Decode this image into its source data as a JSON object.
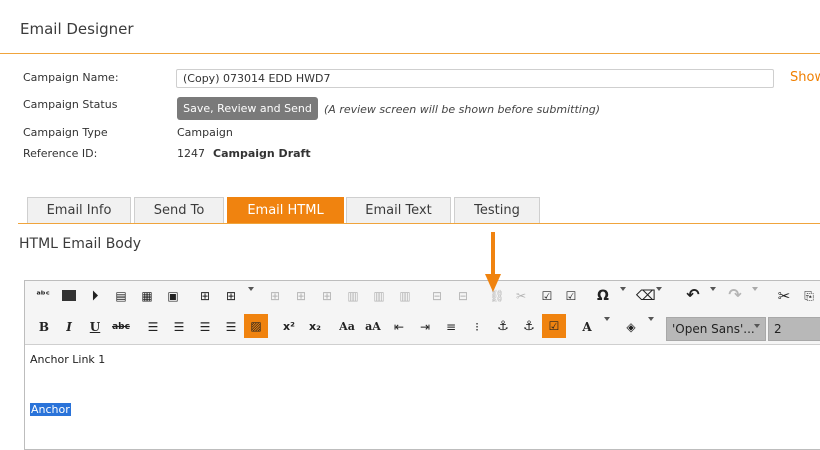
{
  "header": {
    "title": "Email Designer"
  },
  "campaign": {
    "name_label": "Campaign Name:",
    "name_value": "(Copy) 073014 EDD HWD7",
    "show_link": "Show",
    "status_label": "Campaign Status",
    "status_button": "Save, Review and Send",
    "status_note": "(A review screen will be shown before submitting)",
    "type_label": "Campaign Type",
    "type_value": "Campaign",
    "ref_label": "Reference ID:",
    "ref_value": "1247",
    "ref_status": "Campaign Draft"
  },
  "tabs": [
    {
      "label": "Email Info",
      "active": false
    },
    {
      "label": "Send To",
      "active": false
    },
    {
      "label": "Email HTML",
      "active": true
    },
    {
      "label": "Email Text",
      "active": false
    },
    {
      "label": "Testing",
      "active": false
    }
  ],
  "section_title": "HTML Email Body",
  "toolbar": {
    "row1_icons": [
      "spellcheck-icon",
      "image-icon",
      "media-icon",
      "template-icon",
      "page-icon",
      "picture-icon",
      "table-icon",
      "table-grid-icon",
      "table-row-before-icon",
      "table-row-after-icon",
      "table-col-icon",
      "table-cell-icon",
      "table-merge-icon",
      "table-split-icon",
      "table-props-icon",
      "link-icon",
      "unlink-icon",
      "edit-icon",
      "edit-source-icon",
      "special-char-icon",
      "clean-icon",
      "undo-icon",
      "redo-icon",
      "cut-icon",
      "copy-icon"
    ],
    "row2_icons": [
      "bold-icon",
      "italic-icon",
      "underline-icon",
      "strikethrough-icon",
      "align-left-icon",
      "align-center-icon",
      "align-right-icon",
      "justify-icon",
      "hr-icon",
      "superscript-icon",
      "subscript-icon",
      "font-size-up-icon",
      "font-size-down-icon",
      "outdent-icon",
      "indent-icon",
      "ordered-list-icon",
      "unordered-list-icon",
      "anchor-icon",
      "anchor-link-icon",
      "insert-field-icon",
      "font-color-icon",
      "highlight-icon"
    ],
    "bold": "B",
    "italic": "I",
    "underline": "U",
    "strike": "abc",
    "superscript": "x²",
    "subscript": "x₂",
    "font_up": "Aa",
    "font_down": "aA",
    "font_color": "A",
    "omega": "Ω",
    "font_family": "'Open Sans'...",
    "font_size": "2"
  },
  "content": {
    "line1": "Anchor Link 1",
    "selected": "Anchor"
  },
  "colors": {
    "accent": "#f0830f",
    "selection": "#2a73d9",
    "button": "#7a7a7a"
  }
}
